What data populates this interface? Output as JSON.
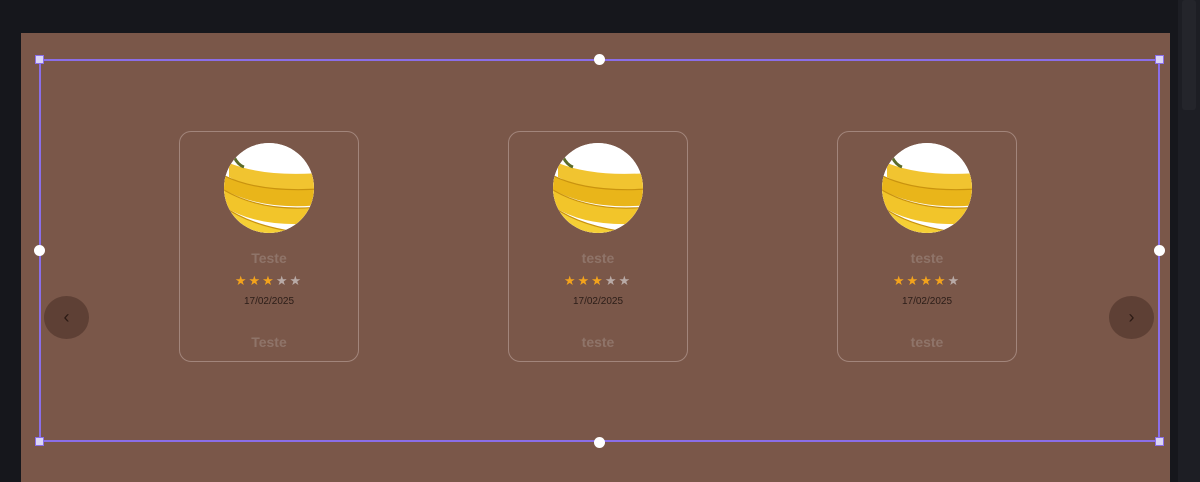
{
  "carousel": {
    "prev_icon": "‹",
    "next_icon": "›",
    "cards": [
      {
        "name": "Teste",
        "rating": 3,
        "max_rating": 5,
        "date": "17/02/2025",
        "comment": "Teste",
        "image": "banana-photo"
      },
      {
        "name": "teste",
        "rating": 3,
        "max_rating": 5,
        "date": "17/02/2025",
        "comment": "teste",
        "image": "banana-photo"
      },
      {
        "name": "teste",
        "rating": 4,
        "max_rating": 5,
        "date": "17/02/2025",
        "comment": "teste",
        "image": "banana-photo"
      }
    ]
  },
  "colors": {
    "canvas_bg": "#7a5749",
    "selection": "#8a6ee8",
    "star_active": "#f3a31c",
    "star_inactive": "#b8aaa6"
  }
}
